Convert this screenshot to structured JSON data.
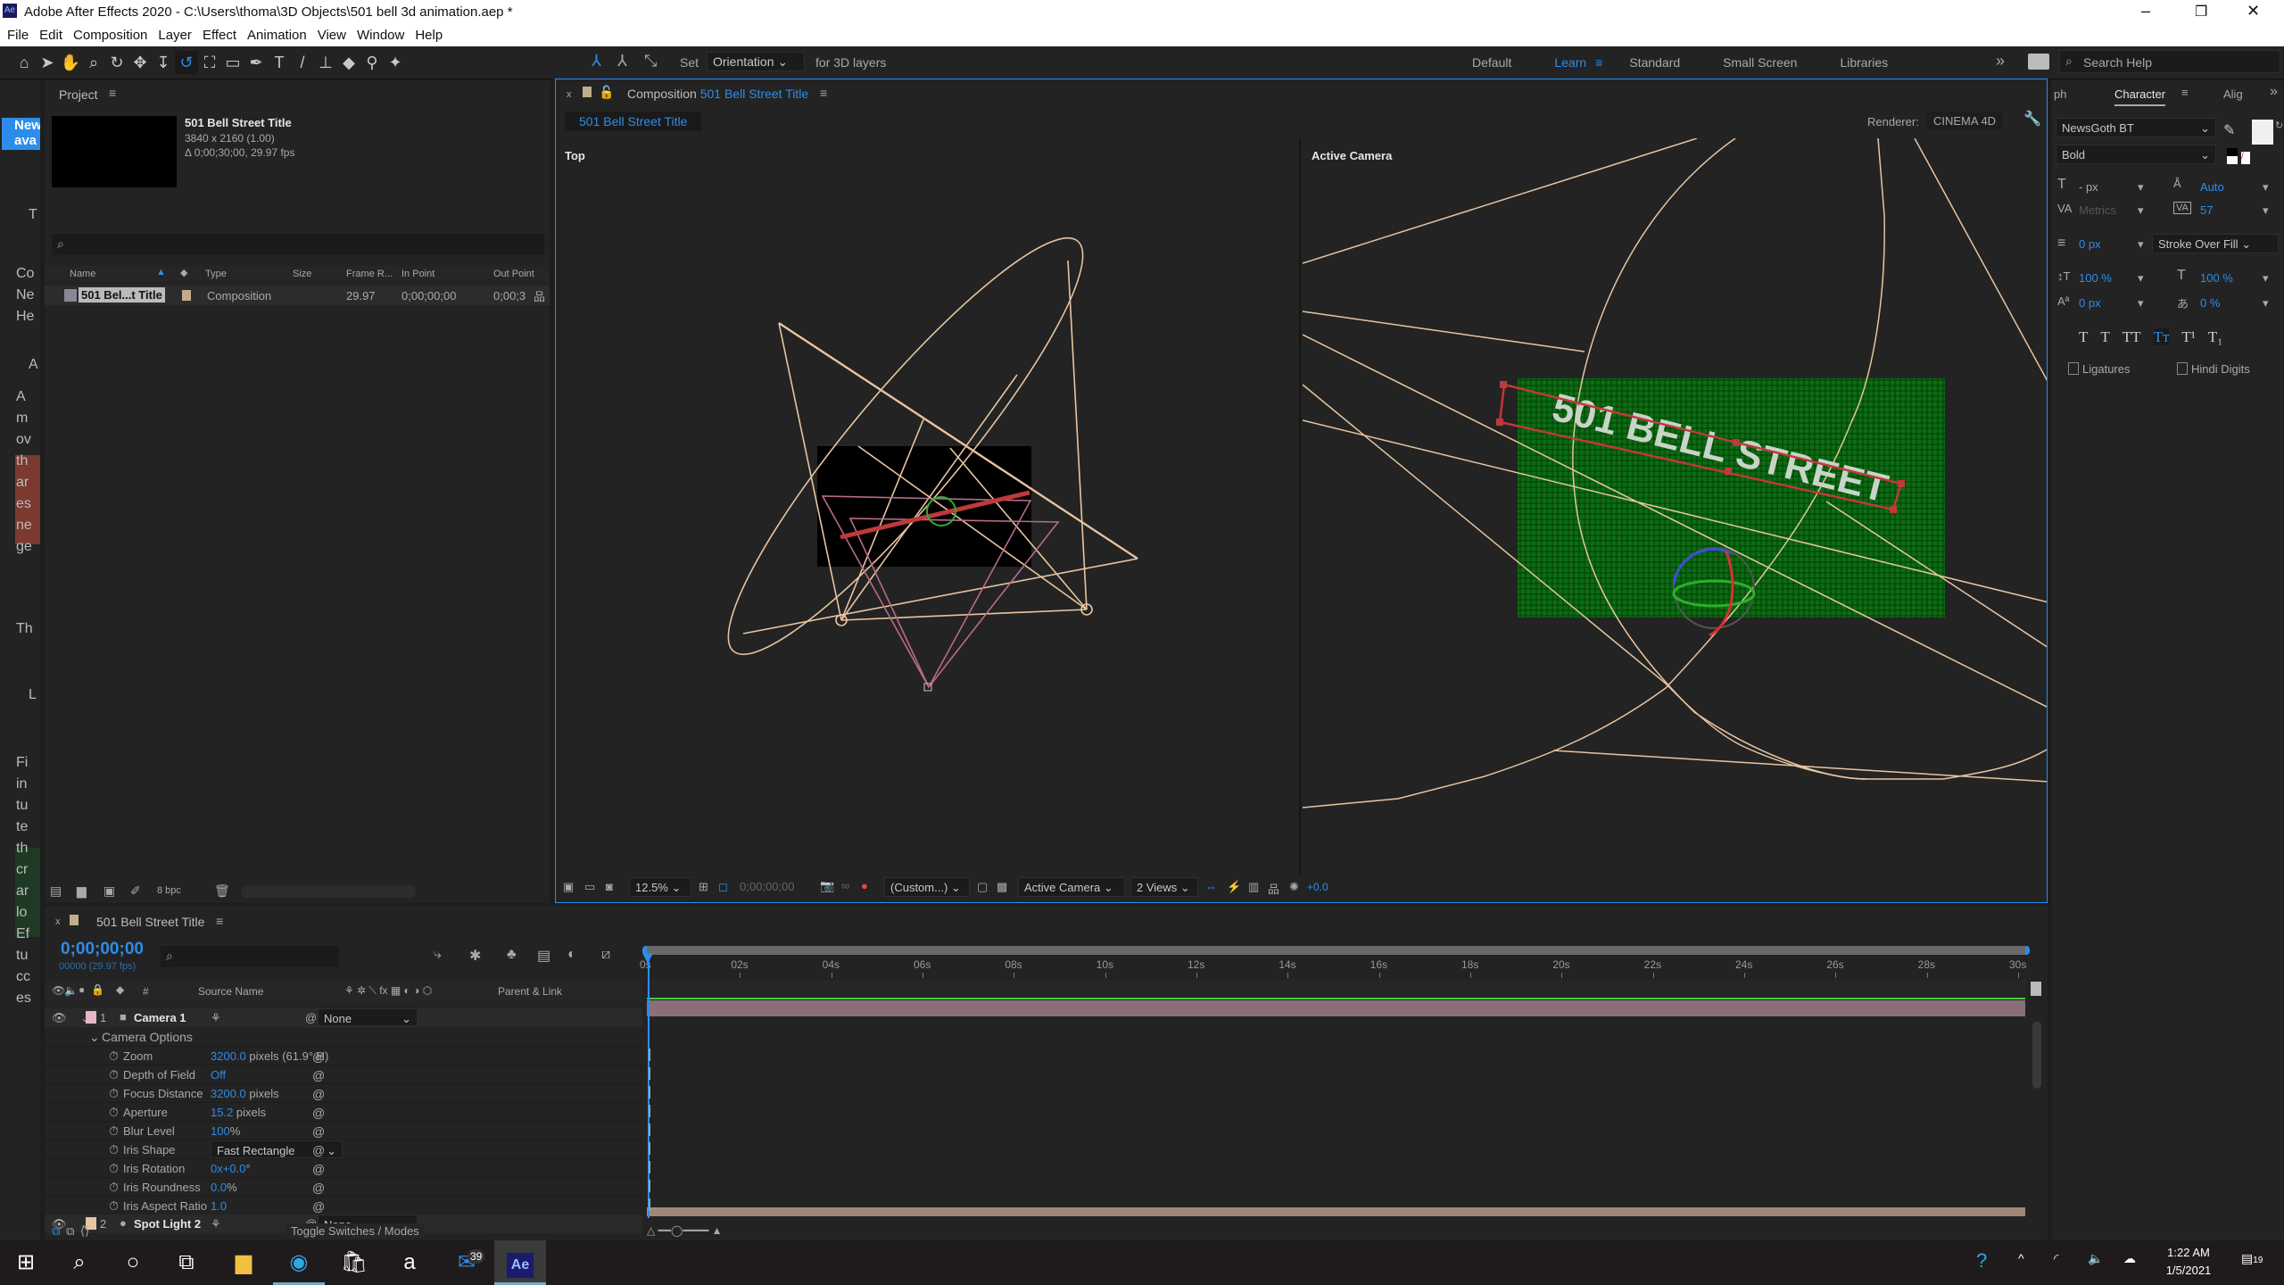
{
  "window": {
    "title": "Adobe After Effects 2020 - C:\\Users\\thoma\\3D Objects\\501 bell 3d animation.aep *",
    "app_icon": "Ae",
    "controls": [
      "minimize-icon",
      "restore-icon",
      "close-icon"
    ]
  },
  "menu": [
    "File",
    "Edit",
    "Composition",
    "Layer",
    "Effect",
    "Animation",
    "View",
    "Window",
    "Help"
  ],
  "toolbar": {
    "tools": [
      "home",
      "selection",
      "hand",
      "zoom",
      "orbit",
      "pan",
      "dolly",
      "rotate",
      "pan-behind",
      "rectangle",
      "pen",
      "type",
      "brush",
      "clone-stamp",
      "eraser",
      "roto-brush",
      "puppet"
    ],
    "axis_mode_label": "Set",
    "axis_select": "Orientation",
    "axis_suffix": "for 3D layers",
    "workspaces": [
      "Default",
      "Learn",
      "Standard",
      "Small Screen",
      "Libraries"
    ],
    "active_workspace": "Learn",
    "search_placeholder": "Search Help"
  },
  "learn_strip": {
    "banner": "New ava",
    "fragments": [
      "T",
      "Co",
      "Ne",
      "He",
      "A",
      "A",
      "m",
      "ov",
      "th",
      "ar",
      "es",
      "ne",
      "ge",
      "Th",
      "L",
      "Fi",
      "in",
      "tu",
      "te",
      "th",
      "cr",
      "ar",
      "lo",
      "Ef",
      "tu",
      "cc",
      "es"
    ]
  },
  "project": {
    "title": "Project",
    "item_name": "501 Bell Street Title",
    "item_dims": "3840 x 2160 (1.00)",
    "item_duration": "Δ 0;00;30;00, 29.97 fps",
    "search_placeholder": "",
    "columns": [
      "Name",
      "Type",
      "Size",
      "Frame R...",
      "In Point",
      "Out Point"
    ],
    "rows": [
      {
        "name": "501 Bel...t Title",
        "type": "Composition",
        "size": "",
        "frame_rate": "29.97",
        "in_point": "0;00;00;00",
        "out_point": "0;00;3"
      }
    ],
    "bpc": "8 bpc"
  },
  "composition": {
    "tab_prefix": "Composition",
    "tab_name": "501 Bell Street Title",
    "subtab": "501 Bell Street Title",
    "renderer_label": "Renderer:",
    "renderer": "CINEMA 4D",
    "views": [
      {
        "label": "Top"
      },
      {
        "label": "Active Camera"
      }
    ],
    "plane_text": "501 BELL STREET",
    "viewer_toolbar": {
      "zoom": "12.5%",
      "timecode": "0;00;00;00",
      "resolution": "(Custom...)",
      "camera": "Active Camera",
      "view_layout": "2 Views",
      "exposure": "+0.0"
    }
  },
  "character": {
    "tabs": [
      "ph",
      "Character",
      "Alig"
    ],
    "font": "NewsGoth BT",
    "style": "Bold",
    "font_size": "- px",
    "leading": "Auto",
    "kerning": "Metrics",
    "tracking": "57",
    "stroke_width": "0 px",
    "stroke_mode": "Stroke Over Fill",
    "vscale": "100 %",
    "hscale": "100 %",
    "baseline": "0 px",
    "tsume": "0 %",
    "styles": [
      "T",
      "T",
      "TT",
      "Tт",
      "T¹",
      "T₁"
    ],
    "ligatures": "Ligatures",
    "hindi_digits": "Hindi Digits",
    "fill_color": "#f0f0f0",
    "stroke_color": "#000000"
  },
  "timeline": {
    "tab": "501 Bell Street Title",
    "timecode": "0;00;00;00",
    "frame_info": "00000 (29.97 fps)",
    "columns": {
      "num": "#",
      "source": "Source Name",
      "parent": "Parent & Link"
    },
    "ruler": [
      "0s",
      "02s",
      "04s",
      "06s",
      "08s",
      "10s",
      "12s",
      "14s",
      "16s",
      "18s",
      "20s",
      "22s",
      "24s",
      "26s",
      "28s",
      "30s"
    ],
    "layers": [
      {
        "num": "1",
        "name": "Camera 1",
        "parent": "None",
        "label_color": "#e8b4c8",
        "bar_color": "#8b6f78"
      },
      {
        "num": "2",
        "name": "Spot Light 2",
        "parent": "None",
        "label_color": "#e8c4a0",
        "bar_color": "#a08878"
      }
    ],
    "group": "Camera Options",
    "properties": [
      {
        "name": "Zoom",
        "value": "3200.0",
        "unit": " pixels (61.9° H)"
      },
      {
        "name": "Depth of Field",
        "value": "Off",
        "unit": ""
      },
      {
        "name": "Focus Distance",
        "value": "3200.0",
        "unit": " pixels"
      },
      {
        "name": "Aperture",
        "value": "15.2",
        "unit": " pixels"
      },
      {
        "name": "Blur Level",
        "value": "100",
        "unit": "%"
      },
      {
        "name": "Iris Shape",
        "value": "Fast Rectangle",
        "unit": "",
        "dropdown": true
      },
      {
        "name": "Iris Rotation",
        "value": "0x+0.0",
        "unit": "°"
      },
      {
        "name": "Iris Roundness",
        "value": "0.0",
        "unit": "%"
      },
      {
        "name": "Iris Aspect Ratio",
        "value": "1.0",
        "unit": ""
      }
    ],
    "toggle_label": "Toggle Switches / Modes"
  },
  "taskbar": {
    "mail_badge": "39",
    "time": "1:22 AM",
    "date": "1/5/2021",
    "notifications": "19"
  },
  "colors": {
    "accent": "#2d8ceb",
    "panel": "#232323",
    "wire": "#e8c4a0",
    "selection": "#c0393b",
    "plane": "#0b6e12"
  }
}
